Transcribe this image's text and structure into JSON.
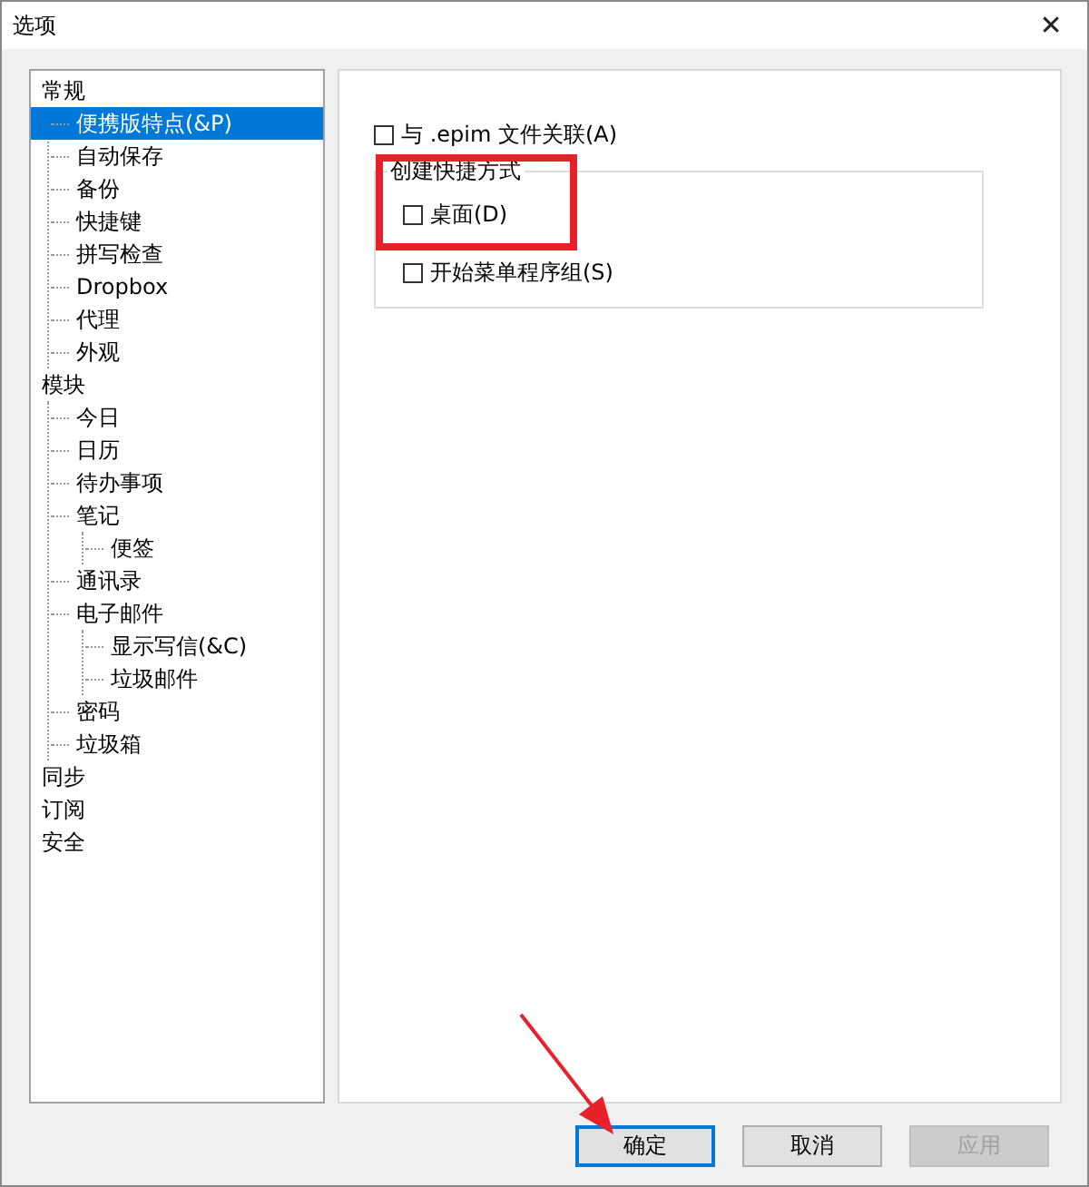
{
  "window": {
    "title": "选项",
    "close": "✕"
  },
  "tree": [
    {
      "label": "常规",
      "selected": false,
      "children": [
        {
          "label": "便携版特点(&P)",
          "selected": true
        },
        {
          "label": "自动保存",
          "selected": false
        },
        {
          "label": "备份",
          "selected": false
        },
        {
          "label": "快捷键",
          "selected": false
        },
        {
          "label": "拼写检查",
          "selected": false
        },
        {
          "label": "Dropbox",
          "selected": false
        },
        {
          "label": "代理",
          "selected": false
        },
        {
          "label": "外观",
          "selected": false
        }
      ]
    },
    {
      "label": "模块",
      "selected": false,
      "children": [
        {
          "label": "今日",
          "selected": false
        },
        {
          "label": "日历",
          "selected": false
        },
        {
          "label": "待办事项",
          "selected": false
        },
        {
          "label": "笔记",
          "selected": false,
          "children": [
            {
              "label": "便签",
              "selected": false
            }
          ]
        },
        {
          "label": "通讯录",
          "selected": false
        },
        {
          "label": "电子邮件",
          "selected": false,
          "children": [
            {
              "label": "显示写信(&C)",
              "selected": false
            },
            {
              "label": "垃圾邮件",
              "selected": false
            }
          ]
        },
        {
          "label": "密码",
          "selected": false
        },
        {
          "label": "垃圾箱",
          "selected": false
        }
      ]
    },
    {
      "label": "同步",
      "selected": false
    },
    {
      "label": "订阅",
      "selected": false
    },
    {
      "label": "安全",
      "selected": false
    }
  ],
  "associate": {
    "label": "与 .epim 文件关联(A)",
    "checked": false
  },
  "shortcut_group": {
    "title": "创建快捷方式",
    "options": [
      {
        "label": "桌面(D)",
        "checked": false
      },
      {
        "label": "开始菜单程序组(S)",
        "checked": false
      }
    ]
  },
  "buttons": [
    {
      "label": "确定",
      "default": true,
      "disabled": false
    },
    {
      "label": "取消",
      "default": false,
      "disabled": false
    },
    {
      "label": "应用",
      "default": false,
      "disabled": true
    }
  ]
}
